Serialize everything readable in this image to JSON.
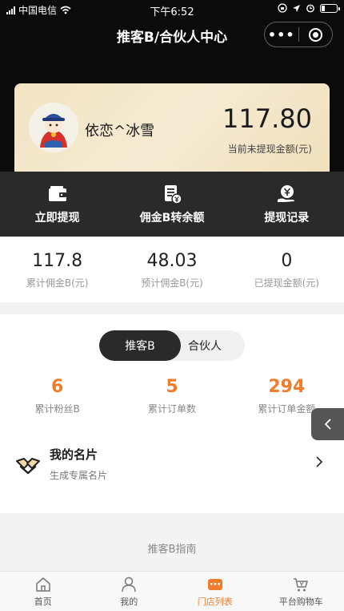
{
  "status_bar": {
    "carrier": "中国电信",
    "time": "下午6:52"
  },
  "nav": {
    "title": "推客B/合伙人中心",
    "more": "•••"
  },
  "profile": {
    "nickname": "依恋^冰雪",
    "balance": "117.80",
    "balance_label": "当前未提现金额(元)"
  },
  "actions": [
    {
      "label": "立即提现",
      "icon": "wallet-icon"
    },
    {
      "label": "佣金B转余额",
      "icon": "document-coin-icon"
    },
    {
      "label": "提现记录",
      "icon": "yen-hand-icon"
    }
  ],
  "stats": [
    {
      "value": "117.8",
      "label": "累计佣金B(元)"
    },
    {
      "value": "48.03",
      "label": "预计佣金B(元)"
    },
    {
      "value": "0",
      "label": "已提现金额(元)"
    }
  ],
  "segment": {
    "left": "推客B",
    "right": "合伙人",
    "selected": "推客B"
  },
  "stats2": [
    {
      "value": "6",
      "label": "累计粉丝B"
    },
    {
      "value": "5",
      "label": "累计订单数"
    },
    {
      "value": "294",
      "label": "累计订单金额"
    }
  ],
  "card": {
    "title": "我的名片",
    "subtitle": "生成专属名片"
  },
  "guide": {
    "label": "推客B指南"
  },
  "tabbar": [
    {
      "label": "首页",
      "icon": "home-icon",
      "active": false
    },
    {
      "label": "我的",
      "icon": "user-icon",
      "active": false
    },
    {
      "label": "门店列表",
      "icon": "store-list-icon",
      "active": true
    },
    {
      "label": "平台购物车",
      "icon": "cart-icon",
      "active": false
    }
  ],
  "colors": {
    "accent": "#f07c2c",
    "dark": "#0b0b0b",
    "action_bar": "#2a2a2a",
    "gold_card": "#f2e4c3"
  }
}
